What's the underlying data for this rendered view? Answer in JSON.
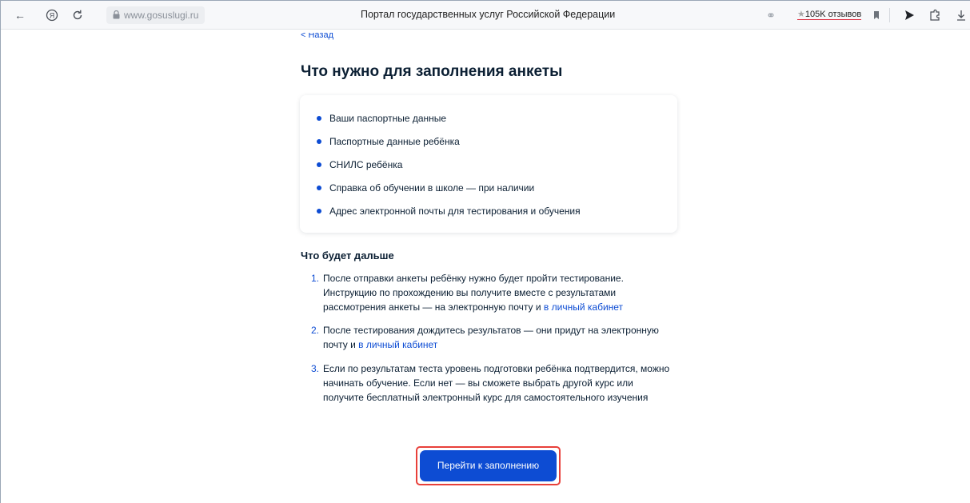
{
  "browser": {
    "url": "www.gosuslugi.ru",
    "page_title": "Портал государственных услуг Российской Федерации",
    "reviews": "105K отзывов"
  },
  "nav": {
    "back_label": "< Назад"
  },
  "main": {
    "title": "Что нужно для заполнения анкеты",
    "requirements": [
      "Ваши паспортные данные",
      "Паспортные данные ребёнка",
      "СНИЛС ребёнка",
      "Справка об обучении в школе — при наличии",
      "Адрес электронной почты для тестирования и обучения"
    ],
    "next_title": "Что будет дальше",
    "steps": [
      {
        "num": "1.",
        "text": "После отправки анкеты ребёнку нужно будет пройти тестирование. Инструкцию по прохождению вы получите вместе с результатами рассмотрения анкеты — на электронную почту и ",
        "link": "в личный кабинет"
      },
      {
        "num": "2.",
        "text": "После тестирования дождитесь результатов — они придут на электронную почту и ",
        "link": "в личный кабинет"
      },
      {
        "num": "3.",
        "text": "Если по результатам теста уровень подготовки ребёнка подтвердится, можно начинать обучение. Если нет — вы сможете выбрать другой курс или получите бесплатный электронный курс для самостоятельного изучения",
        "link": ""
      }
    ],
    "cta_label": "Перейти к заполнению"
  },
  "colors": {
    "accent": "#0d4cd3",
    "highlight": "#e8403a",
    "text": "#0b1f33"
  }
}
